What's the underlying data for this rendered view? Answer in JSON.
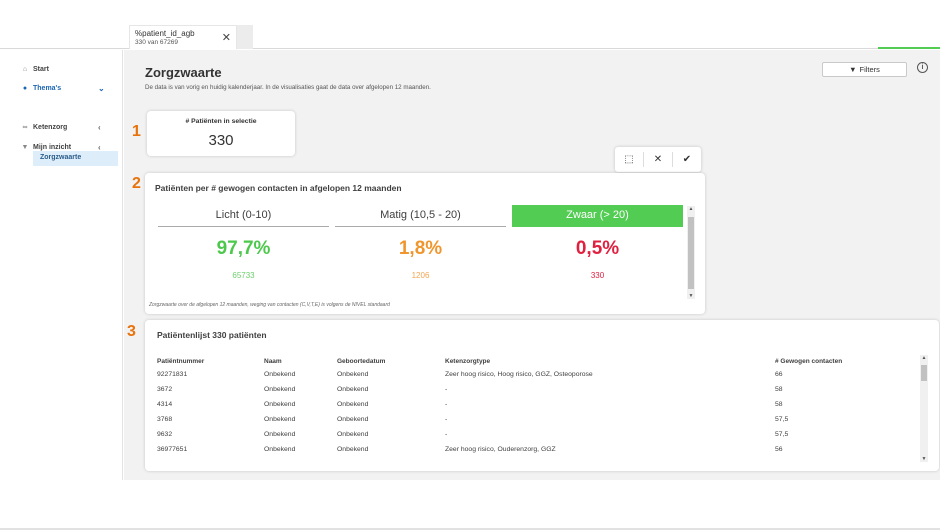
{
  "selection": {
    "field": "%patient_id_agb",
    "count": "330 van 67269",
    "close": "✕"
  },
  "sidebar": {
    "items": [
      {
        "label": "Start",
        "icon": "home-icon"
      },
      {
        "label": "Thema's",
        "icon": "lightbulb-icon",
        "active": true,
        "chevron": "⌄"
      },
      {
        "label": "Ketenzorg",
        "icon": "link-icon",
        "chevron": "‹"
      },
      {
        "label": "Mijn inzicht",
        "icon": "funnel-icon",
        "chevron": "‹"
      }
    ],
    "sub_item": "Zorgzwaarte"
  },
  "header": {
    "title": "Zorgzwaarte",
    "subtitle": "De data is van vorig en huidig kalenderjaar. In de visualisaties gaat de data over afgelopen 12 maanden.",
    "filters_label": "Filters",
    "info": "i"
  },
  "markers": [
    "1",
    "2",
    "3"
  ],
  "kpi": {
    "title": "# Patiënten in selectie",
    "value": "330"
  },
  "toolbar": {
    "select": "⬚",
    "cancel": "✕",
    "confirm": "✔"
  },
  "categories_card": {
    "title": "Patiënten per # gewogen contacten in afgelopen 12 maanden",
    "footnote": "Zorgzwaarte over de afgelopen 12 maanden, weging van contacten (C,V,T,E) is volgens de NIVEL standaard",
    "categories": [
      {
        "label": "Licht (0-10)",
        "pct": "97,7%",
        "count": "65733",
        "color": "#4cc94c",
        "count_color": "#6ccf6c",
        "selected": false
      },
      {
        "label": "Matig (10,5 - 20)",
        "pct": "1,8%",
        "count": "1206",
        "color": "#f0962e",
        "count_color": "#f0a550",
        "selected": false
      },
      {
        "label": "Zwaar (> 20)",
        "pct": "0,5%",
        "count": "330",
        "color": "#e0203f",
        "count_color": "#e0203f",
        "selected": true
      }
    ],
    "selected_color": "#52cc52"
  },
  "patient_list": {
    "title": "Patiëntenlijst 330 patiënten",
    "columns": [
      "Patiëntnummer",
      "Naam",
      "Geboortedatum",
      "Ketenzorgtype",
      "# Gewogen contacten"
    ],
    "rows": [
      [
        "92271831",
        "Onbekend",
        "Onbekend",
        "Zeer hoog risico, Hoog risico, GGZ, Osteoporose",
        "66"
      ],
      [
        "3672",
        "Onbekend",
        "Onbekend",
        "-",
        "58"
      ],
      [
        "4314",
        "Onbekend",
        "Onbekend",
        "-",
        "58"
      ],
      [
        "3768",
        "Onbekend",
        "Onbekend",
        "-",
        "57,5"
      ],
      [
        "9632",
        "Onbekend",
        "Onbekend",
        "-",
        "57,5"
      ],
      [
        "36977651",
        "Onbekend",
        "Onbekend",
        "Zeer hoog risico, Ouderenzorg, GGZ",
        "56"
      ]
    ]
  }
}
